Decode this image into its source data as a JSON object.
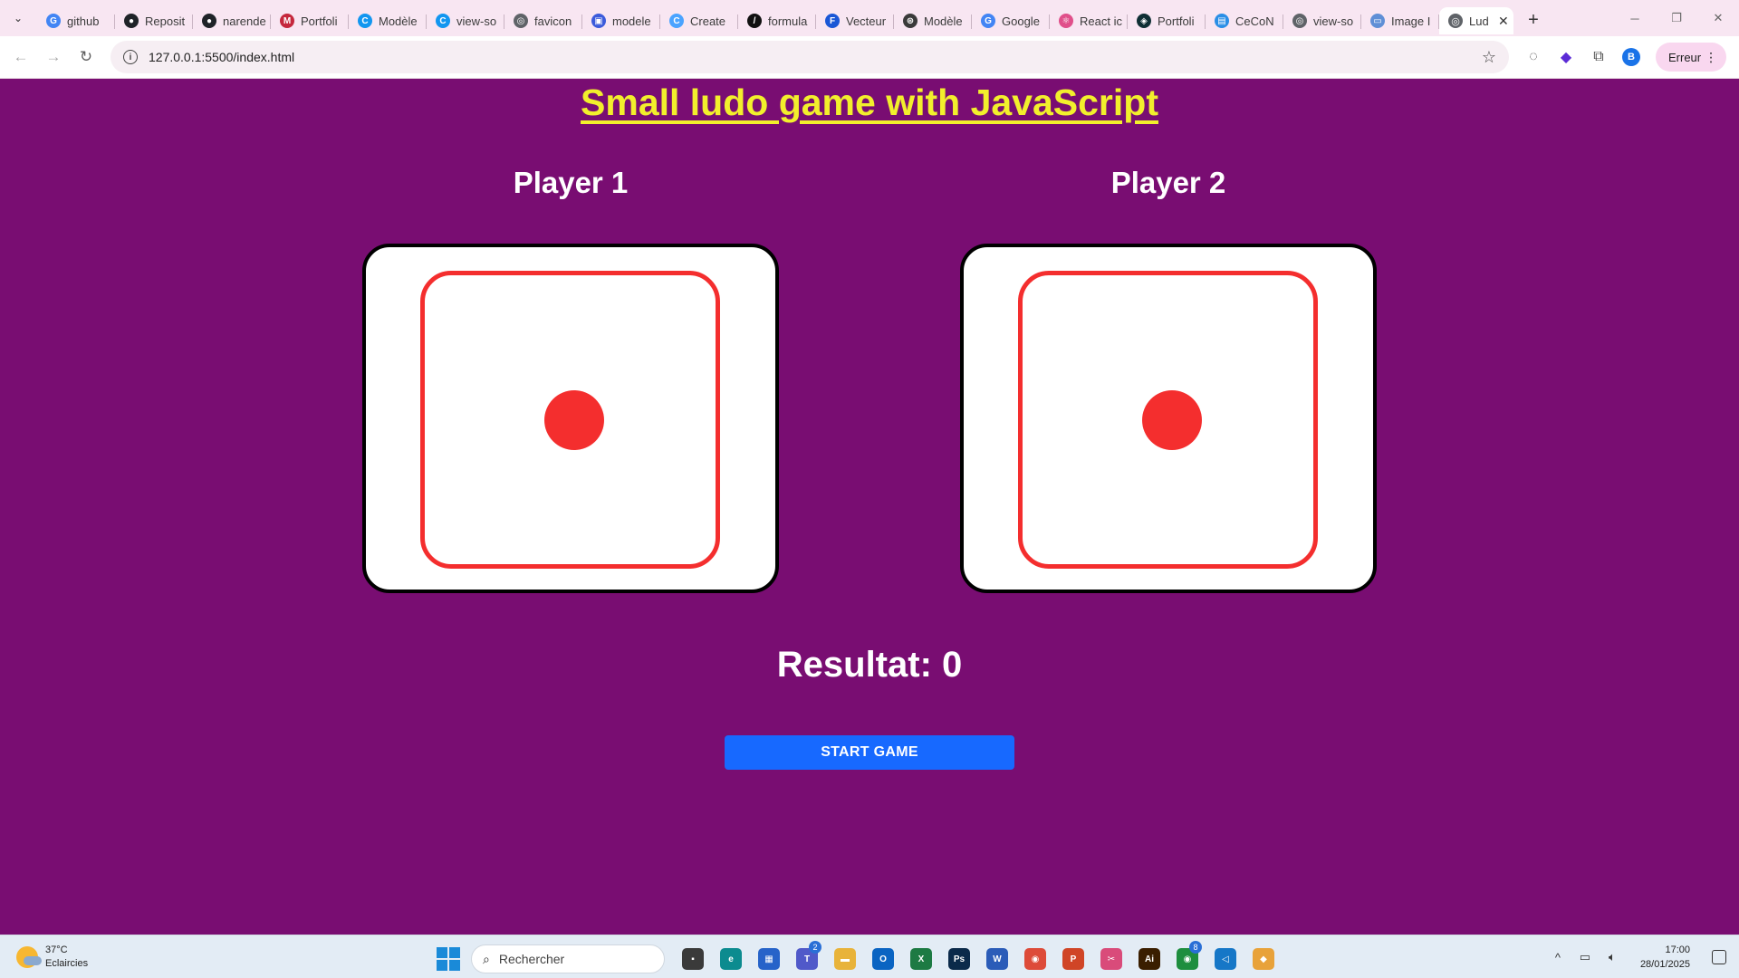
{
  "browser": {
    "tabs": [
      {
        "label": "github",
        "icon": "google-icon",
        "color": "#4285f4",
        "glyph": "G"
      },
      {
        "label": "Reposit",
        "icon": "github-icon",
        "color": "#1f2328",
        "glyph": "●"
      },
      {
        "label": "narende",
        "icon": "github-icon",
        "color": "#1f2328",
        "glyph": "●"
      },
      {
        "label": "Portfoli",
        "icon": "portfolio-icon",
        "color": "#c5283d",
        "glyph": "M"
      },
      {
        "label": "Modèle",
        "icon": "canva-icon",
        "color": "#1296f0",
        "glyph": "C"
      },
      {
        "label": "view-so",
        "icon": "canva-icon",
        "color": "#1296f0",
        "glyph": "C"
      },
      {
        "label": "favicon",
        "icon": "globe-icon",
        "color": "#5f6368",
        "glyph": "◎"
      },
      {
        "label": "modele",
        "icon": "image-icon",
        "color": "#3b5bdb",
        "glyph": "▣"
      },
      {
        "label": "Create",
        "icon": "canva-icon",
        "color": "#4aa3ff",
        "glyph": "C"
      },
      {
        "label": "formula",
        "icon": "terminal-icon",
        "color": "#111111",
        "glyph": "/"
      },
      {
        "label": "Vecteur",
        "icon": "vector-icon",
        "color": "#1a57d6",
        "glyph": "F"
      },
      {
        "label": "Modèle",
        "icon": "openai-icon",
        "color": "#3a3a3a",
        "glyph": "⊛"
      },
      {
        "label": "Google",
        "icon": "translate-icon",
        "color": "#4285f4",
        "glyph": "G"
      },
      {
        "label": "React ic",
        "icon": "react-icon",
        "color": "#e04f8a",
        "glyph": "⚛"
      },
      {
        "label": "Portfoli",
        "icon": "portfolio-icon",
        "color": "#0f2f34",
        "glyph": "◈"
      },
      {
        "label": "CeCoN",
        "icon": "doc-icon",
        "color": "#2a8ee6",
        "glyph": "▤"
      },
      {
        "label": "view-so",
        "icon": "globe-icon",
        "color": "#5f6368",
        "glyph": "◎"
      },
      {
        "label": "Image I",
        "icon": "image-icon",
        "color": "#5f8fd6",
        "glyph": "▭"
      }
    ],
    "active_tab": {
      "label": "Lud",
      "icon": "globe-icon"
    },
    "url": "127.0.0.1:5500/index.html",
    "profile_letter": "B",
    "error_label": "Erreur"
  },
  "page": {
    "title": "Small ludo game with JavaScript",
    "player1": "Player 1",
    "player2": "Player 2",
    "result": "Resultat: 0",
    "start_button": "START GAME",
    "die1_value": 1,
    "die2_value": 1,
    "colors": {
      "background": "#790d72",
      "title": "#f2ef2c",
      "pip": "#f42e2e",
      "button": "#1769ff"
    }
  },
  "taskbar": {
    "weather_temp": "37°C",
    "weather_desc": "Eclaircies",
    "search_placeholder": "Rechercher",
    "time": "17:00",
    "date": "28/01/2025",
    "apps": [
      {
        "name": "file-explorer-small-icon",
        "color": "#3a3a3a",
        "glyph": "▪"
      },
      {
        "name": "edge-icon",
        "color": "#0c8b8f",
        "glyph": "e"
      },
      {
        "name": "store-icon",
        "color": "#2663c9",
        "glyph": "▦"
      },
      {
        "name": "teams-icon",
        "color": "#5059c9",
        "glyph": "T",
        "badge": "2"
      },
      {
        "name": "folder-icon",
        "color": "#e8b33a",
        "glyph": "▬"
      },
      {
        "name": "outlook-icon",
        "color": "#0a64c2",
        "glyph": "O"
      },
      {
        "name": "excel-icon",
        "color": "#1d7a43",
        "glyph": "X"
      },
      {
        "name": "photoshop-icon",
        "color": "#0b2a4a",
        "glyph": "Ps"
      },
      {
        "name": "word-icon",
        "color": "#2b5cb8",
        "glyph": "W"
      },
      {
        "name": "chrome-icon",
        "color": "#dd4b39",
        "glyph": "◉"
      },
      {
        "name": "powerpoint-icon",
        "color": "#d04526",
        "glyph": "P"
      },
      {
        "name": "snipping-icon",
        "color": "#d94b7a",
        "glyph": "✂"
      },
      {
        "name": "illustrator-icon",
        "color": "#3a1e00",
        "glyph": "Ai"
      },
      {
        "name": "chrome-profile-icon",
        "color": "#1e8e3e",
        "glyph": "◉",
        "badge": "8"
      },
      {
        "name": "vscode-icon",
        "color": "#1677c7",
        "glyph": "◁"
      },
      {
        "name": "git-icon",
        "color": "#e8a23a",
        "glyph": "◆"
      }
    ]
  }
}
